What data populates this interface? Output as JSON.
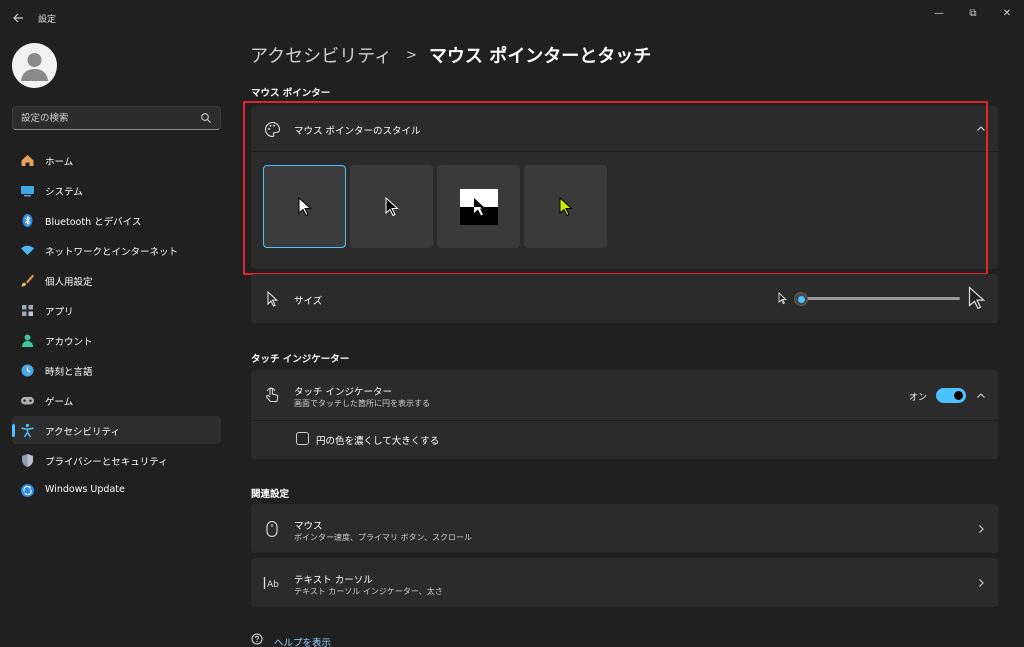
{
  "window": {
    "title": "設定",
    "controls": {
      "minimize": "—",
      "maximize": "⧉",
      "close": "✕"
    }
  },
  "sidebar": {
    "search_placeholder": "設定の検索",
    "items": [
      {
        "label": "ホーム",
        "icon": "home-icon",
        "color": "#e8a25c"
      },
      {
        "label": "システム",
        "icon": "system-icon",
        "color": "#3fa7e6"
      },
      {
        "label": "Bluetooth とデバイス",
        "icon": "bluetooth-icon",
        "color": "#2b8de8"
      },
      {
        "label": "ネットワークとインターネット",
        "icon": "wifi-icon",
        "color": "#4cb6f0"
      },
      {
        "label": "個人用設定",
        "icon": "brush-icon",
        "color": "#e8933c"
      },
      {
        "label": "アプリ",
        "icon": "apps-icon",
        "color": "#9aa6b8"
      },
      {
        "label": "アカウント",
        "icon": "account-icon",
        "color": "#3fc7a0"
      },
      {
        "label": "時刻と言語",
        "icon": "time-language-icon",
        "color": "#4aa8e8"
      },
      {
        "label": "ゲーム",
        "icon": "gaming-icon",
        "color": "#b0b0b0"
      },
      {
        "label": "アクセシビリティ",
        "icon": "accessibility-icon",
        "color": "#4cc2ff",
        "active": true
      },
      {
        "label": "プライバシーとセキュリティ",
        "icon": "shield-icon",
        "color": "#8f9bb0"
      },
      {
        "label": "Windows Update",
        "icon": "update-icon",
        "color": "#2b8de8"
      }
    ]
  },
  "breadcrumb": {
    "parent": "アクセシビリティ",
    "separator": ">",
    "current": "マウス ポインターとタッチ"
  },
  "mouse_pointer": {
    "section_title": "マウス ポインター",
    "style_title": "マウス ポインターのスタイル",
    "styles": [
      "white",
      "black",
      "inverted",
      "custom"
    ],
    "selected_style": "white",
    "custom_color": "#c6f000",
    "size_label": "サイズ",
    "size_level": 0
  },
  "touch": {
    "section_title": "タッチ インジケーター",
    "title": "タッチ インジケーター",
    "subtitle": "画面でタッチした箇所に円を表示する",
    "toggle_label": "オン",
    "toggle_on": true,
    "checkbox_label": "円の色を濃くして大きくする",
    "checkbox_checked": false
  },
  "related": {
    "section_title": "関連設定",
    "items": [
      {
        "title": "マウス",
        "subtitle": "ポインター速度、プライマリ ボタン、スクロール",
        "icon": "mouse-icon"
      },
      {
        "title": "テキスト カーソル",
        "subtitle": "テキスト カーソル インジケーター、太さ",
        "icon": "text-cursor-icon"
      }
    ]
  },
  "help_link": "ヘルプを表示",
  "colors": {
    "accent": "#4cc2ff",
    "highlight_border": "#e0242c",
    "background": "#202020",
    "card": "#2b2b2b"
  }
}
